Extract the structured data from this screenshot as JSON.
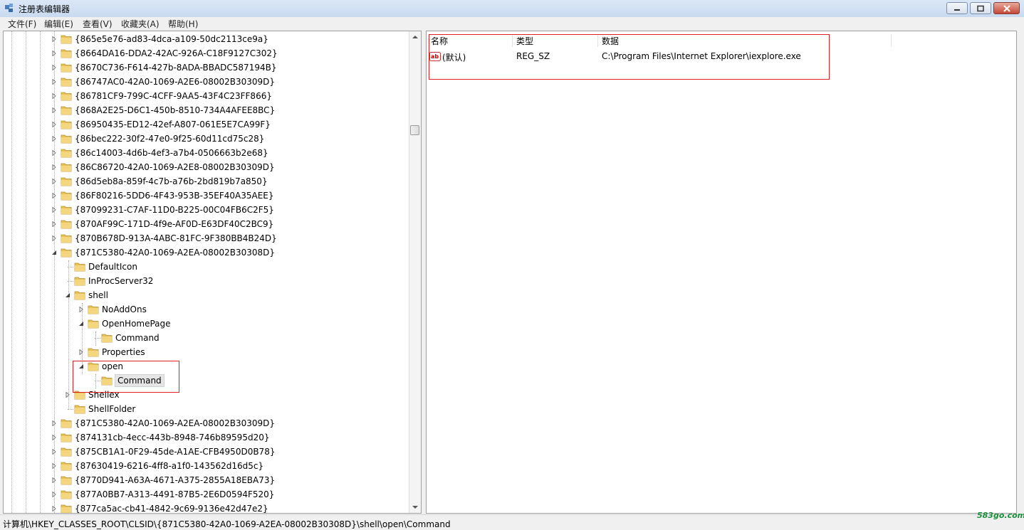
{
  "window": {
    "title": "注册表编辑器"
  },
  "menu": [
    "文件(F)",
    "编辑(E)",
    "查看(V)",
    "收藏夹(A)",
    "帮助(H)"
  ],
  "tree": [
    {
      "label": "{865e5e76-ad83-4dca-a109-50dc2113ce9a}"
    },
    {
      "label": "{8664DA16-DDA2-42AC-926A-C18F9127C302}"
    },
    {
      "label": "{8670C736-F614-427b-8ADA-BBADC587194B}"
    },
    {
      "label": "{86747AC0-42A0-1069-A2E6-08002B30309D}"
    },
    {
      "label": "{86781CF9-799C-4CFF-9AA5-43F4C23FF866}"
    },
    {
      "label": "{868A2E25-D6C1-450b-8510-734A4AFEE8BC}"
    },
    {
      "label": "{86950435-ED12-42ef-A807-061E5E7CA99F}"
    },
    {
      "label": "{86bec222-30f2-47e0-9f25-60d11cd75c28}"
    },
    {
      "label": "{86c14003-4d6b-4ef3-a7b4-0506663b2e68}"
    },
    {
      "label": "{86C86720-42A0-1069-A2E8-08002B30309D}"
    },
    {
      "label": "{86d5eb8a-859f-4c7b-a76b-2bd819b7a850}"
    },
    {
      "label": "{86F80216-5DD6-4F43-953B-35EF40A35AEE}"
    },
    {
      "label": "{87099231-C7AF-11D0-B225-00C04FB6C2F5}"
    },
    {
      "label": "{870AF99C-171D-4f9e-AF0D-E63DF40C2BC9}"
    },
    {
      "label": "{870B678D-913A-4ABC-81FC-9F380BB4B24D}"
    },
    {
      "label": "{871C5380-42A0-1069-A2EA-08002B30308D}"
    },
    {
      "label": "DefaultIcon"
    },
    {
      "label": "InProcServer32"
    },
    {
      "label": "shell"
    },
    {
      "label": "NoAddOns"
    },
    {
      "label": "OpenHomePage"
    },
    {
      "label": "Command"
    },
    {
      "label": "Properties"
    },
    {
      "label": "open"
    },
    {
      "label": "Command"
    },
    {
      "label": "Shellex"
    },
    {
      "label": "ShellFolder"
    },
    {
      "label": "{871C5380-42A0-1069-A2EA-08002B30309D}"
    },
    {
      "label": "{874131cb-4ecc-443b-8948-746b89595d20}"
    },
    {
      "label": "{875CB1A1-0F29-45de-A1AE-CFB4950D0B78}"
    },
    {
      "label": "{87630419-6216-4ff8-a1f0-143562d16d5c}"
    },
    {
      "label": "{8770D941-A63A-4671-A375-2855A18EBA73}"
    },
    {
      "label": "{877A0BB7-A313-4491-87B5-2E6D0594F520}"
    },
    {
      "label": "{877ca5ac-cb41-4842-9c69-9136e42d47e2}"
    }
  ],
  "list": {
    "headers": {
      "name": "名称",
      "type": "类型",
      "data": "数据"
    },
    "rows": [
      {
        "name": "(默认)",
        "type": "REG_SZ",
        "data": "C:\\Program Files\\Internet Explorer\\iexplore.exe"
      }
    ]
  },
  "status": {
    "path": "计算机\\HKEY_CLASSES_ROOT\\CLSID\\{871C5380-42A0-1069-A2EA-08002B30308D}\\shell\\open\\Command"
  },
  "watermark": "583go.com",
  "colors": {
    "highlight_box": "#e02020",
    "folder": "#e8c15a",
    "titlebar": "#c9daf0"
  }
}
